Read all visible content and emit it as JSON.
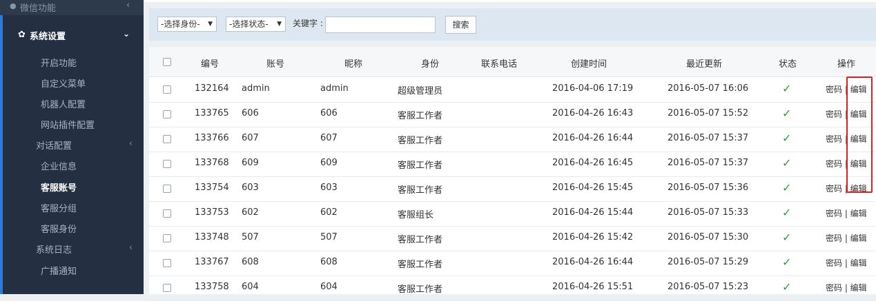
{
  "sidebar": {
    "top_item": {
      "icon": "wechat-icon",
      "label": "微信功能",
      "chevron": "‹"
    },
    "section": {
      "icon": "gear-icon",
      "label": "系统设置",
      "chevron": "⌄"
    },
    "items": [
      {
        "label": "开启功能"
      },
      {
        "label": "自定义菜单"
      },
      {
        "label": "机器人配置"
      },
      {
        "label": "网站插件配置"
      },
      {
        "label": "对话配置",
        "chevron": "‹"
      },
      {
        "label": "企业信息"
      },
      {
        "label": "客服账号"
      },
      {
        "label": "客服分组"
      },
      {
        "label": "客服身份"
      },
      {
        "label": "系统日志",
        "chevron": "‹"
      },
      {
        "label": "广播通知"
      }
    ]
  },
  "filter": {
    "identity_select": "-选择身份-",
    "status_select": "-选择状态-",
    "keyword_label": "关键字 :",
    "keyword_value": "",
    "search_label": "搜索"
  },
  "table": {
    "headers": {
      "id": "编号",
      "account": "账号",
      "nickname": "昵称",
      "identity": "身份",
      "phone": "联系电话",
      "created": "创建时间",
      "updated": "最近更新",
      "status": "状态",
      "ops": "操作"
    },
    "rows": [
      {
        "id": "132164",
        "account": "admin",
        "nickname": "admin",
        "identity": "超级管理员",
        "phone": "",
        "created": "2016-04-06 17:19",
        "updated": "2016-05-07 16:06",
        "status": "✓",
        "ops": "密码 | 编辑"
      },
      {
        "id": "133765",
        "account": "606",
        "nickname": "606",
        "identity": "客服工作者",
        "phone": "",
        "created": "2016-04-26 16:43",
        "updated": "2016-05-07 15:52",
        "status": "✓",
        "ops": "密码 | 编辑"
      },
      {
        "id": "133766",
        "account": "607",
        "nickname": "607",
        "identity": "客服工作者",
        "phone": "",
        "created": "2016-04-26 16:44",
        "updated": "2016-05-07 15:37",
        "status": "✓",
        "ops": "密码 | 编辑"
      },
      {
        "id": "133768",
        "account": "609",
        "nickname": "609",
        "identity": "客服工作者",
        "phone": "",
        "created": "2016-04-26 16:45",
        "updated": "2016-05-07 15:37",
        "status": "✓",
        "ops": "密码 | 编辑"
      },
      {
        "id": "133754",
        "account": "603",
        "nickname": "603",
        "identity": "客服工作者",
        "phone": "",
        "created": "2016-04-26 15:45",
        "updated": "2016-05-07 15:36",
        "status": "✓",
        "ops": "密码 | 编辑"
      },
      {
        "id": "133753",
        "account": "602",
        "nickname": "602",
        "identity": "客服组长",
        "phone": "",
        "created": "2016-04-26 15:44",
        "updated": "2016-05-07 15:33",
        "status": "✓",
        "ops": "密码 | 编辑"
      },
      {
        "id": "133748",
        "account": "507",
        "nickname": "507",
        "identity": "客服工作者",
        "phone": "",
        "created": "2016-04-26 15:42",
        "updated": "2016-05-07 15:30",
        "status": "✓",
        "ops": "密码 | 编辑"
      },
      {
        "id": "133767",
        "account": "608",
        "nickname": "608",
        "identity": "客服工作者",
        "phone": "",
        "created": "2016-04-26 16:44",
        "updated": "2016-05-07 15:29",
        "status": "✓",
        "ops": "密码 | 编辑"
      },
      {
        "id": "133758",
        "account": "604",
        "nickname": "604",
        "identity": "客服工作者",
        "phone": "",
        "created": "2016-04-26 15:51",
        "updated": "2016-05-07 15:23",
        "status": "✓",
        "ops": "密码 | 编辑"
      }
    ]
  },
  "colors": {
    "sidebar": "#2c3a4b",
    "accent": "#2d7bd4",
    "status_ok": "#2e9c3a",
    "highlight": "#d92020"
  }
}
